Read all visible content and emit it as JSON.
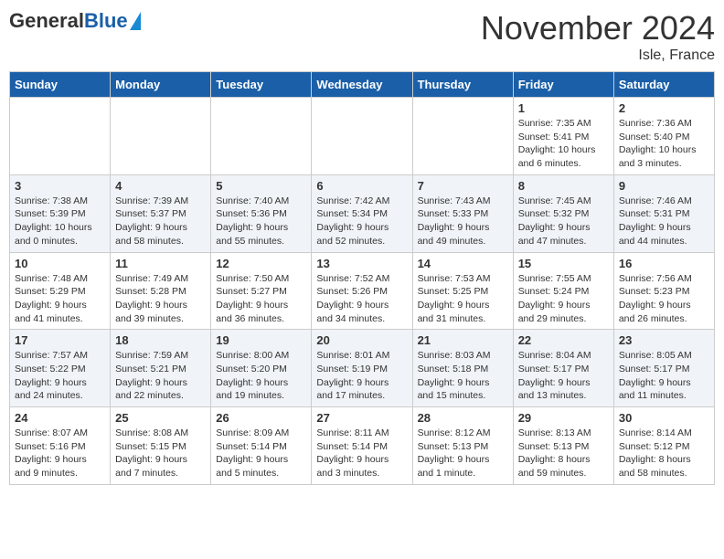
{
  "header": {
    "logo_general": "General",
    "logo_blue": "Blue",
    "month": "November 2024",
    "location": "Isle, France"
  },
  "days_of_week": [
    "Sunday",
    "Monday",
    "Tuesday",
    "Wednesday",
    "Thursday",
    "Friday",
    "Saturday"
  ],
  "weeks": [
    [
      {
        "day": "",
        "info": ""
      },
      {
        "day": "",
        "info": ""
      },
      {
        "day": "",
        "info": ""
      },
      {
        "day": "",
        "info": ""
      },
      {
        "day": "",
        "info": ""
      },
      {
        "day": "1",
        "info": "Sunrise: 7:35 AM\nSunset: 5:41 PM\nDaylight: 10 hours and 6 minutes."
      },
      {
        "day": "2",
        "info": "Sunrise: 7:36 AM\nSunset: 5:40 PM\nDaylight: 10 hours and 3 minutes."
      }
    ],
    [
      {
        "day": "3",
        "info": "Sunrise: 7:38 AM\nSunset: 5:39 PM\nDaylight: 10 hours and 0 minutes."
      },
      {
        "day": "4",
        "info": "Sunrise: 7:39 AM\nSunset: 5:37 PM\nDaylight: 9 hours and 58 minutes."
      },
      {
        "day": "5",
        "info": "Sunrise: 7:40 AM\nSunset: 5:36 PM\nDaylight: 9 hours and 55 minutes."
      },
      {
        "day": "6",
        "info": "Sunrise: 7:42 AM\nSunset: 5:34 PM\nDaylight: 9 hours and 52 minutes."
      },
      {
        "day": "7",
        "info": "Sunrise: 7:43 AM\nSunset: 5:33 PM\nDaylight: 9 hours and 49 minutes."
      },
      {
        "day": "8",
        "info": "Sunrise: 7:45 AM\nSunset: 5:32 PM\nDaylight: 9 hours and 47 minutes."
      },
      {
        "day": "9",
        "info": "Sunrise: 7:46 AM\nSunset: 5:31 PM\nDaylight: 9 hours and 44 minutes."
      }
    ],
    [
      {
        "day": "10",
        "info": "Sunrise: 7:48 AM\nSunset: 5:29 PM\nDaylight: 9 hours and 41 minutes."
      },
      {
        "day": "11",
        "info": "Sunrise: 7:49 AM\nSunset: 5:28 PM\nDaylight: 9 hours and 39 minutes."
      },
      {
        "day": "12",
        "info": "Sunrise: 7:50 AM\nSunset: 5:27 PM\nDaylight: 9 hours and 36 minutes."
      },
      {
        "day": "13",
        "info": "Sunrise: 7:52 AM\nSunset: 5:26 PM\nDaylight: 9 hours and 34 minutes."
      },
      {
        "day": "14",
        "info": "Sunrise: 7:53 AM\nSunset: 5:25 PM\nDaylight: 9 hours and 31 minutes."
      },
      {
        "day": "15",
        "info": "Sunrise: 7:55 AM\nSunset: 5:24 PM\nDaylight: 9 hours and 29 minutes."
      },
      {
        "day": "16",
        "info": "Sunrise: 7:56 AM\nSunset: 5:23 PM\nDaylight: 9 hours and 26 minutes."
      }
    ],
    [
      {
        "day": "17",
        "info": "Sunrise: 7:57 AM\nSunset: 5:22 PM\nDaylight: 9 hours and 24 minutes."
      },
      {
        "day": "18",
        "info": "Sunrise: 7:59 AM\nSunset: 5:21 PM\nDaylight: 9 hours and 22 minutes."
      },
      {
        "day": "19",
        "info": "Sunrise: 8:00 AM\nSunset: 5:20 PM\nDaylight: 9 hours and 19 minutes."
      },
      {
        "day": "20",
        "info": "Sunrise: 8:01 AM\nSunset: 5:19 PM\nDaylight: 9 hours and 17 minutes."
      },
      {
        "day": "21",
        "info": "Sunrise: 8:03 AM\nSunset: 5:18 PM\nDaylight: 9 hours and 15 minutes."
      },
      {
        "day": "22",
        "info": "Sunrise: 8:04 AM\nSunset: 5:17 PM\nDaylight: 9 hours and 13 minutes."
      },
      {
        "day": "23",
        "info": "Sunrise: 8:05 AM\nSunset: 5:17 PM\nDaylight: 9 hours and 11 minutes."
      }
    ],
    [
      {
        "day": "24",
        "info": "Sunrise: 8:07 AM\nSunset: 5:16 PM\nDaylight: 9 hours and 9 minutes."
      },
      {
        "day": "25",
        "info": "Sunrise: 8:08 AM\nSunset: 5:15 PM\nDaylight: 9 hours and 7 minutes."
      },
      {
        "day": "26",
        "info": "Sunrise: 8:09 AM\nSunset: 5:14 PM\nDaylight: 9 hours and 5 minutes."
      },
      {
        "day": "27",
        "info": "Sunrise: 8:11 AM\nSunset: 5:14 PM\nDaylight: 9 hours and 3 minutes."
      },
      {
        "day": "28",
        "info": "Sunrise: 8:12 AM\nSunset: 5:13 PM\nDaylight: 9 hours and 1 minute."
      },
      {
        "day": "29",
        "info": "Sunrise: 8:13 AM\nSunset: 5:13 PM\nDaylight: 8 hours and 59 minutes."
      },
      {
        "day": "30",
        "info": "Sunrise: 8:14 AM\nSunset: 5:12 PM\nDaylight: 8 hours and 58 minutes."
      }
    ]
  ]
}
